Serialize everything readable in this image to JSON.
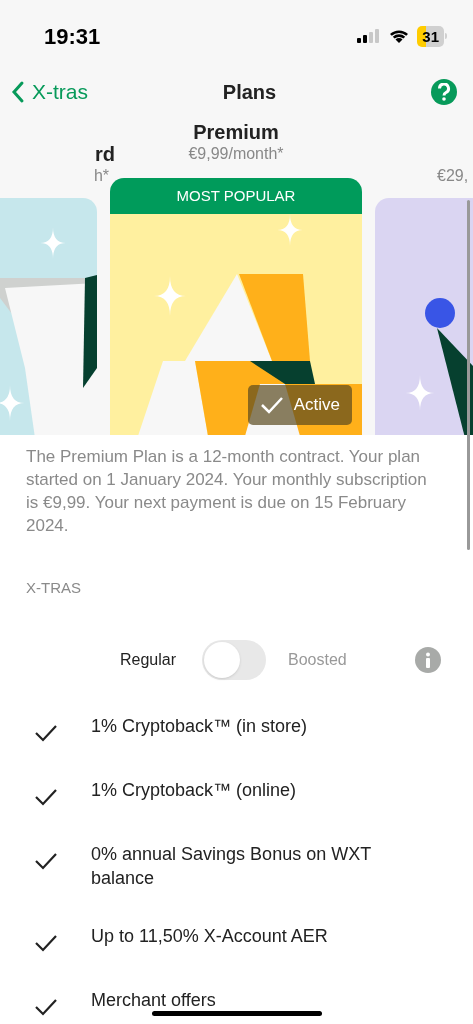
{
  "status_bar": {
    "time": "19:31",
    "battery": "31"
  },
  "nav": {
    "back": "X-tras",
    "title": "Plans"
  },
  "plans": [
    {
      "title": "rd",
      "price": "h*",
      "selected": false
    },
    {
      "title": "Premium",
      "price": "€9,99/month*",
      "badge": "MOST POPULAR",
      "status": "Active",
      "selected": true
    },
    {
      "price": "€29,",
      "selected": false
    }
  ],
  "description": "The Premium Plan is a 12-month contract. Your plan started on 1 January 2024. Your monthly subscription is €9,99. Your next payment is due on 15 February 2024.",
  "section_label": "X-TRAS",
  "mode_toggle": {
    "left_label": "Regular",
    "right_label": "Boosted",
    "on": false
  },
  "features": [
    {
      "text": "1% Cryptoback™ (in store)",
      "checked": true
    },
    {
      "text": "1% Cryptoback™ (online)",
      "checked": true
    },
    {
      "text": "0% annual Savings Bonus on WXT balance",
      "checked": true
    },
    {
      "text": "Up to 11,50% X-Account AER",
      "checked": true
    },
    {
      "text": "Merchant offers",
      "checked": true
    }
  ]
}
